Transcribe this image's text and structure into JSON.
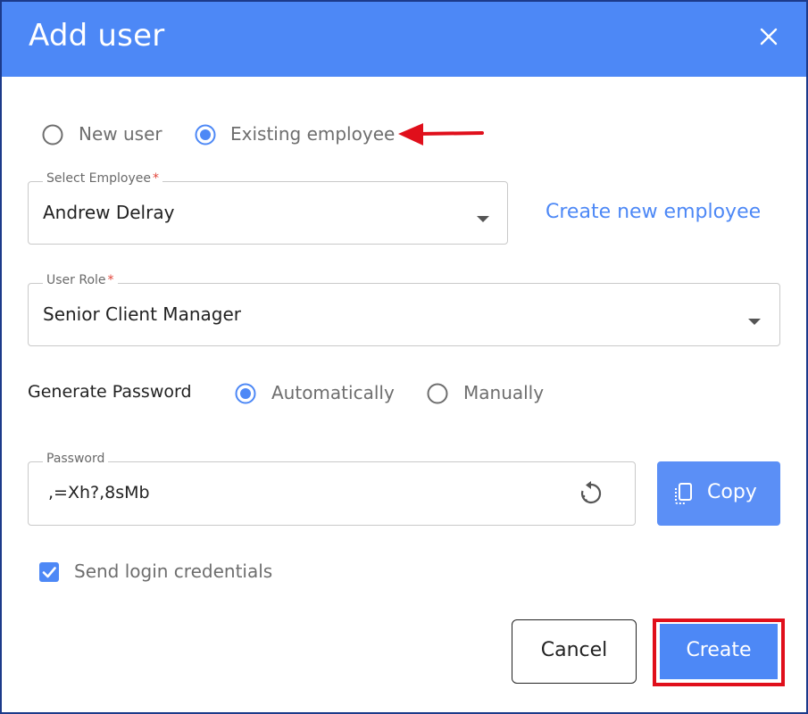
{
  "dialog": {
    "title": "Add user"
  },
  "user_type": {
    "options": [
      {
        "label": "New user",
        "selected": false
      },
      {
        "label": "Existing employee",
        "selected": true
      }
    ]
  },
  "employee": {
    "label": "Select Employee",
    "required_mark": "*",
    "value": "Andrew Delray",
    "create_link": "Create new employee"
  },
  "role": {
    "label": "User Role",
    "required_mark": "*",
    "value": "Senior Client Manager"
  },
  "generate_password": {
    "label": "Generate Password",
    "options": [
      {
        "label": "Automatically",
        "selected": true
      },
      {
        "label": "Manually",
        "selected": false
      }
    ]
  },
  "password": {
    "label": "Password",
    "value": ",=Xh?,8sMb",
    "copy_label": "Copy"
  },
  "send_credentials": {
    "label": "Send login credentials",
    "checked": true
  },
  "actions": {
    "cancel": "Cancel",
    "create": "Create"
  },
  "colors": {
    "primary": "#4d88f6",
    "highlight": "#e00f1b",
    "annotation_arrow": "#e00f1b"
  },
  "icons": [
    "close-icon",
    "radio-icon",
    "chevron-down-icon",
    "regenerate-icon",
    "copy-icon",
    "checkbox-check-icon",
    "annotation-arrow-icon"
  ]
}
